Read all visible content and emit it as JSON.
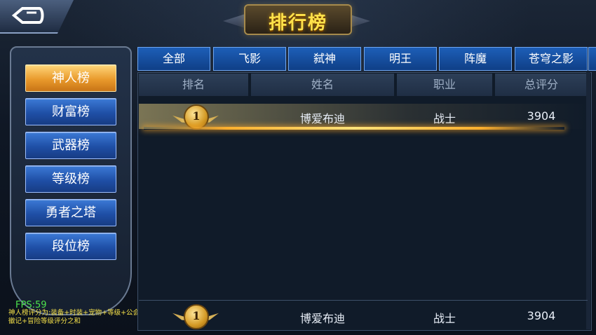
{
  "header": {
    "title": "排行榜",
    "back_icon": "back-arrow-icon"
  },
  "sidebar": {
    "items": [
      {
        "label": "神人榜",
        "active": true
      },
      {
        "label": "财富榜",
        "active": false
      },
      {
        "label": "武器榜",
        "active": false
      },
      {
        "label": "等级榜",
        "active": false
      },
      {
        "label": "勇者之塔",
        "active": false
      },
      {
        "label": "段位榜",
        "active": false
      }
    ]
  },
  "status": {
    "fps": "FPS:59"
  },
  "note": "神人榜评分为:装备+时装+宠物+等级+公会徽记+冒险等级评分之和",
  "tabs": [
    "全部",
    "飞影",
    "弑神",
    "明王",
    "阵魔",
    "苍穹之影"
  ],
  "table": {
    "columns": [
      "排名",
      "姓名",
      "职业",
      "总评分"
    ],
    "rows": [
      {
        "rank": "1",
        "name": "博爱布迪",
        "job": "战士",
        "score": "3904"
      }
    ]
  },
  "my_rank": {
    "rank": "1",
    "name": "博爱布迪",
    "job": "战士",
    "score": "3904"
  },
  "colors": {
    "accent_gold": "#e99a2c",
    "tab_blue": "#1d5fb8",
    "medal_gold": "#d49a25"
  }
}
